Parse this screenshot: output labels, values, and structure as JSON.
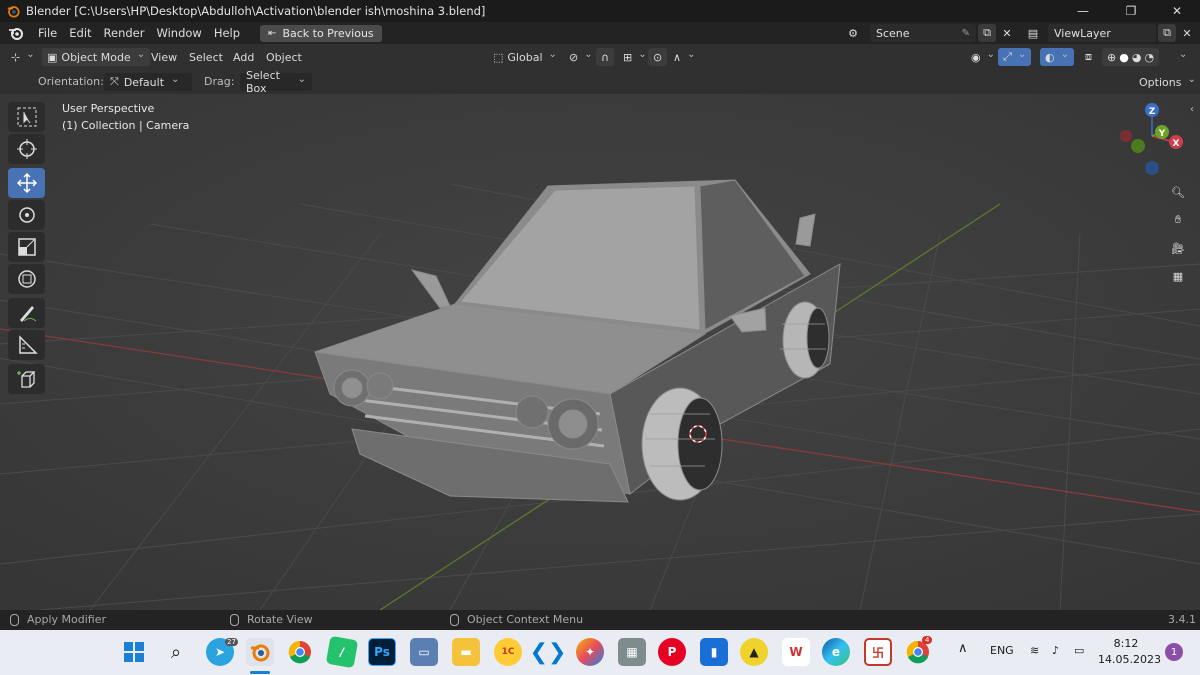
{
  "window": {
    "title": "Blender [C:\\Users\\HP\\Desktop\\Abdulloh\\Activation\\blender ish\\moshina 3.blend]",
    "controls": [
      "minimize",
      "restore",
      "close"
    ]
  },
  "menubar": {
    "items": [
      "File",
      "Edit",
      "Render",
      "Window",
      "Help"
    ],
    "back_button": "Back to Previous",
    "scene_label": "Scene",
    "view_layer_label": "ViewLayer"
  },
  "header": {
    "mode": "Object Mode",
    "menus": [
      "View",
      "Select",
      "Add",
      "Object"
    ],
    "transform_orientation": "Global"
  },
  "tool_settings": {
    "orientation_label": "Orientation:",
    "orientation_value": "Default",
    "drag_label": "Drag:",
    "drag_value": "Select Box",
    "options": "Options"
  },
  "viewport": {
    "perspective": "User Perspective",
    "collection": "(1) Collection | Camera",
    "gizmo_axes": [
      "Z",
      "Y",
      "X"
    ]
  },
  "toolbar": {
    "tools": [
      "select-box-tool",
      "cursor-tool",
      "move-tool",
      "rotate-tool",
      "scale-tool",
      "transform-tool",
      "annotate-tool",
      "measure-tool",
      "add-cube-tool"
    ],
    "active_tool": "move-tool"
  },
  "statusbar": {
    "left_hint": "Apply Modifier",
    "middle_hint": "Rotate View",
    "right_hint": "Object Context Menu",
    "version": "3.4.1"
  },
  "taskbar": {
    "language": "ENG",
    "time": "8:12",
    "date": "14.05.2023",
    "notification_count": "1",
    "telegram_badge": "27",
    "chrome_badge": "4"
  }
}
